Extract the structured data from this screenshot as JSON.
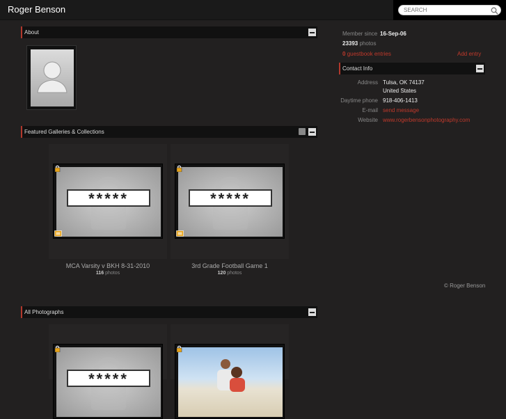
{
  "header": {
    "site_title": "Roger Benson",
    "search_placeholder": "SEARCH"
  },
  "about": {
    "title": "About"
  },
  "featured": {
    "title": "Featured Galleries & Collections",
    "galleries": [
      {
        "title": "MCA Varsity v BKH 8-31-2010",
        "count": "116",
        "count_label": "photos",
        "password_mask": "*****"
      },
      {
        "title": "3rd Grade Football Game 1",
        "count": "120",
        "count_label": "photos",
        "password_mask": "*****"
      }
    ]
  },
  "all_photos": {
    "title": "All Photographs",
    "password_mask": "*****"
  },
  "sidebar": {
    "member_since_label": "Member since",
    "member_since_value": "16-Sep-06",
    "photo_count": "23393",
    "photo_label": "photos",
    "guestbook_count": "0",
    "guestbook_label": "guestbook entries",
    "add_entry": "Add entry",
    "contact_title": "Contact Info",
    "contact": {
      "address_label": "Address",
      "address_line1": "Tulsa, OK 74137",
      "address_line2": "United States",
      "phone_label": "Daytime phone",
      "phone_value": "918-406-1413",
      "email_label": "E-mail",
      "email_value": "send message",
      "website_label": "Website",
      "website_value": "www.rogerbensonphotography.com"
    },
    "copyright": "© Roger Benson"
  },
  "colors": {
    "accent": "#c0392b",
    "background": "#222020",
    "header_bar": "#111111"
  }
}
